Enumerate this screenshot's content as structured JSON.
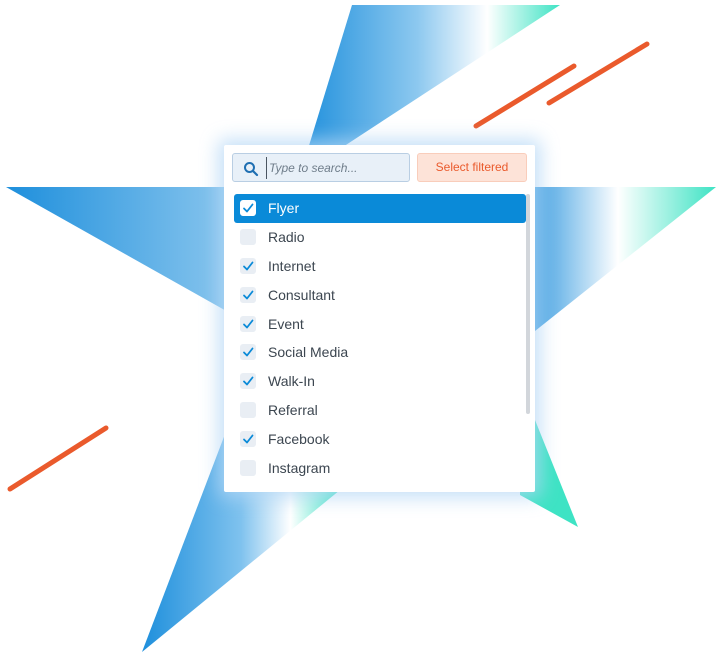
{
  "search": {
    "placeholder": "Type to search...",
    "select_filtered_label": "Select filtered"
  },
  "options": [
    {
      "label": "Flyer",
      "checked": true,
      "active": true
    },
    {
      "label": "Radio",
      "checked": false,
      "active": false
    },
    {
      "label": "Internet",
      "checked": true,
      "active": false
    },
    {
      "label": "Consultant",
      "checked": true,
      "active": false
    },
    {
      "label": "Event",
      "checked": true,
      "active": false
    },
    {
      "label": "Social Media",
      "checked": true,
      "active": false
    },
    {
      "label": "Walk-In",
      "checked": true,
      "active": false
    },
    {
      "label": "Referral",
      "checked": false,
      "active": false
    },
    {
      "label": "Facebook",
      "checked": true,
      "active": false
    },
    {
      "label": "Instagram",
      "checked": false,
      "active": false
    }
  ],
  "icons": {
    "search": "search-icon",
    "check": "checkmark-icon"
  },
  "colors": {
    "accent_blue": "#0a8ad8",
    "accent_orange": "#ea5a2c",
    "select_filtered_bg": "#fde3d8",
    "search_bg": "#e8f0f8"
  }
}
